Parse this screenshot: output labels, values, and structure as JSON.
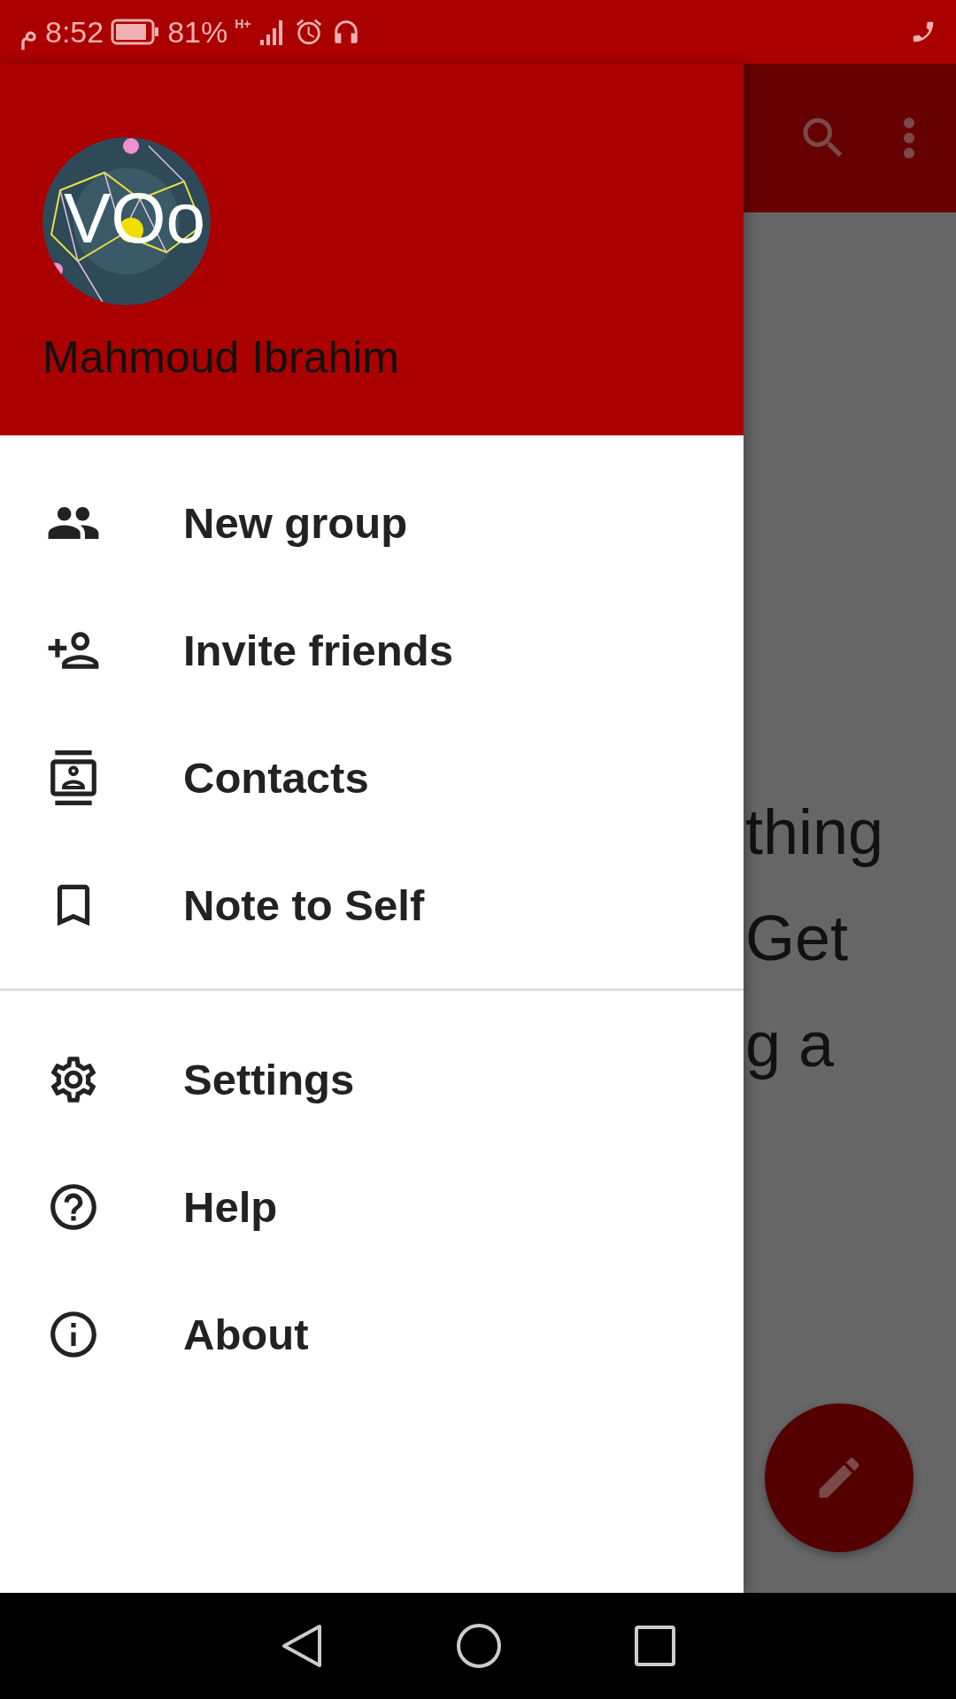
{
  "status_bar": {
    "period": "م",
    "time": "8:52",
    "battery": "81%",
    "network": "H+"
  },
  "profile": {
    "avatar_text": "VOo",
    "name": "Mahmoud Ibrahim"
  },
  "menu_sections": [
    [
      {
        "label": "New group",
        "kind": "group"
      },
      {
        "label": "Invite friends",
        "kind": "invite"
      },
      {
        "label": "Contacts",
        "kind": "contacts"
      },
      {
        "label": "Note to Self",
        "kind": "note"
      }
    ],
    [
      {
        "label": "Settings",
        "kind": "settings"
      },
      {
        "label": "Help",
        "kind": "help"
      },
      {
        "label": "About",
        "kind": "about"
      }
    ]
  ],
  "background_text": [
    "thing",
    "Get",
    "g a"
  ]
}
